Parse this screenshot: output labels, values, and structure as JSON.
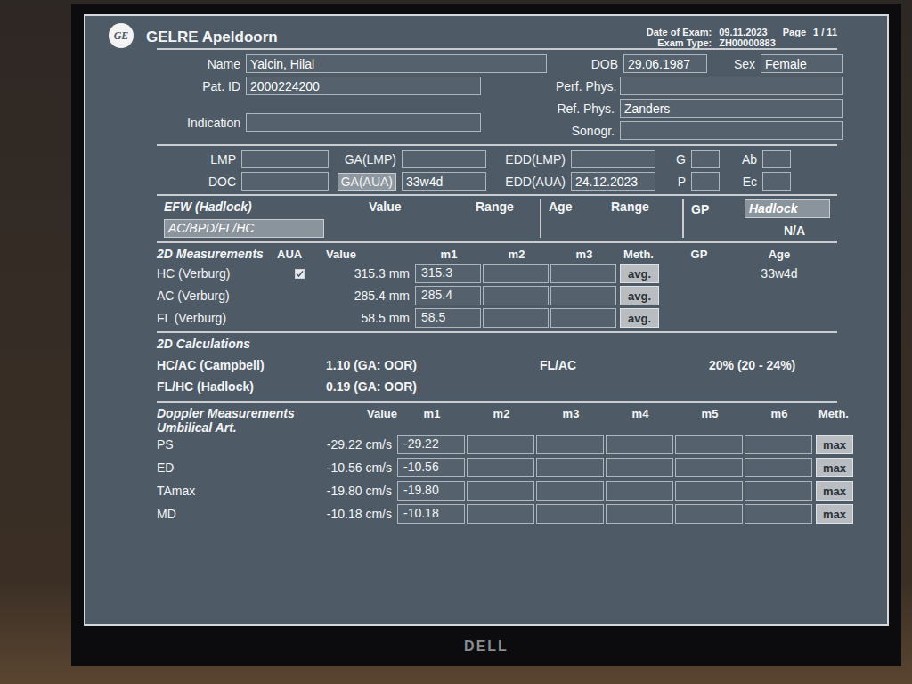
{
  "header": {
    "logo": "GE",
    "title": "GELRE Apeldoorn",
    "date_label": "Date of Exam:",
    "date": "09.11.2023",
    "page_label": "Page",
    "page": "1 / 11",
    "exam_type_label": "Exam Type:",
    "exam_type": "ZH00000883"
  },
  "patient": {
    "left": [
      {
        "label": "Name",
        "value": "Yalcin, Hilal"
      },
      {
        "label": "Pat. ID",
        "value": "2000224200"
      },
      {
        "label": "Indication",
        "value": ""
      }
    ],
    "dob": {
      "label": "DOB",
      "value": "29.06.1987"
    },
    "sex": {
      "label": "Sex",
      "value": "Female"
    },
    "right": [
      {
        "label": "Perf. Phys.",
        "value": ""
      },
      {
        "label": "Ref. Phys.",
        "value": "Zanders"
      },
      {
        "label": "Sonogr.",
        "value": ""
      }
    ]
  },
  "pregnancy": [
    [
      {
        "label": "LMP",
        "value": "",
        "button": false
      },
      {
        "label": "GA(LMP)",
        "value": "",
        "button": false
      },
      {
        "label": "EDD(LMP)",
        "value": "",
        "button": false
      },
      {
        "label": "G",
        "value": "",
        "button": false
      },
      {
        "label": "Ab",
        "value": "",
        "button": false
      }
    ],
    [
      {
        "label": "DOC",
        "value": "",
        "button": false
      },
      {
        "label": "GA(AUA)",
        "value": "33w4d",
        "button": true
      },
      {
        "label": "EDD(AUA)",
        "value": "24.12.2023",
        "button": false
      },
      {
        "label": "P",
        "value": "",
        "button": false
      },
      {
        "label": "Ec",
        "value": "",
        "button": false
      }
    ]
  ],
  "efw": {
    "title": "EFW (Hadlock)",
    "formula": "AC/BPD/FL/HC",
    "value_label": "Value",
    "range_label": "Range",
    "age_label": "Age",
    "age_range_label": "Range",
    "gp_label": "GP",
    "gp_method": "Hadlock",
    "gp_value": "N/A"
  },
  "measurements": {
    "title": "2D Measurements",
    "columns": [
      "AUA",
      "Value",
      "m1",
      "m2",
      "m3",
      "Meth.",
      "GP",
      "Age"
    ],
    "rows": [
      {
        "name": "HC (Verburg)",
        "kind": "checkbox",
        "checked": true,
        "value": "315.3 mm",
        "m": [
          "315.3",
          "",
          ""
        ],
        "meth": "avg.",
        "gp": "",
        "age": "33w4d"
      },
      {
        "name": "AC (Verburg)",
        "kind": "plain",
        "checked": false,
        "value": "285.4 mm",
        "m": [
          "285.4",
          "",
          ""
        ],
        "meth": "avg.",
        "gp": "",
        "age": ""
      },
      {
        "name": "FL (Verburg)",
        "kind": "plain",
        "checked": false,
        "value": "58.5 mm",
        "m": [
          "58.5",
          "",
          ""
        ],
        "meth": "avg.",
        "gp": "",
        "age": ""
      }
    ]
  },
  "calculations": {
    "title": "2D Calculations",
    "items": [
      {
        "label": "HC/AC (Campbell)",
        "value": "1.10 (GA: OOR)"
      },
      {
        "label": "FL/HC (Hadlock)",
        "value": "0.19 (GA: OOR)"
      },
      {
        "label": "FL/AC",
        "value": "20% (20 - 24%)"
      }
    ]
  },
  "doppler": {
    "title": "Doppler Measurements",
    "columns": [
      "Value",
      "m1",
      "m2",
      "m3",
      "m4",
      "m5",
      "m6",
      "Meth."
    ],
    "vessel": "Umbilical Art.",
    "rows": [
      {
        "name": "PS",
        "value": "-29.22 cm/s",
        "m": [
          "-29.22",
          "",
          "",
          "",
          "",
          ""
        ],
        "meth": "max"
      },
      {
        "name": "ED",
        "value": "-10.56 cm/s",
        "m": [
          "-10.56",
          "",
          "",
          "",
          "",
          ""
        ],
        "meth": "max"
      },
      {
        "name": "TAmax",
        "value": "-19.80 cm/s",
        "m": [
          "-19.80",
          "",
          "",
          "",
          "",
          ""
        ],
        "meth": "max"
      },
      {
        "name": "MD",
        "value": "-10.18 cm/s",
        "m": [
          "-10.18",
          "",
          "",
          "",
          "",
          ""
        ],
        "meth": "max"
      }
    ]
  },
  "monitor": {
    "brand": "DELL"
  }
}
